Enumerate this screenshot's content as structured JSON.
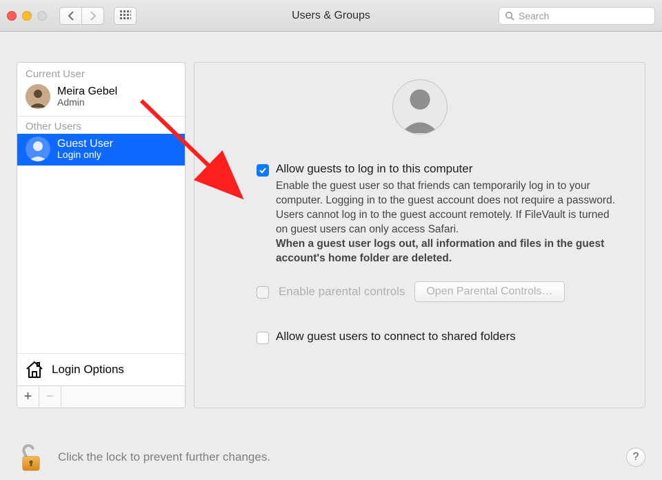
{
  "window": {
    "title": "Users & Groups"
  },
  "search": {
    "placeholder": "Search"
  },
  "sidebar": {
    "current_user_header": "Current User",
    "other_users_header": "Other Users",
    "current_user": {
      "name": "Meira Gebel",
      "role": "Admin"
    },
    "other_users": [
      {
        "name": "Guest User",
        "role": "Login only",
        "selected": true
      }
    ],
    "login_options_label": "Login Options",
    "add_label": "+",
    "remove_label": "−"
  },
  "detail": {
    "allow_guests": {
      "checked": true,
      "label": "Allow guests to log in to this computer",
      "description": "Enable the guest user so that friends can temporarily log in to your computer. Logging in to the guest account does not require a password. Users cannot log in to the guest account remotely. If FileVault is turned on guest users can only access Safari.",
      "note_bold": "When a guest user logs out, all information and files in the guest account's home folder are deleted."
    },
    "parental_controls": {
      "checked": false,
      "enabled": false,
      "label": "Enable parental controls",
      "button": "Open Parental Controls…"
    },
    "allow_shared": {
      "checked": false,
      "label": "Allow guest users to connect to shared folders"
    }
  },
  "lock": {
    "text": "Click the lock to prevent further changes.",
    "help": "?"
  },
  "colors": {
    "accent": "#0a7bff",
    "selected_row": "#0d69ff",
    "arrow": "#ff1f1f"
  }
}
